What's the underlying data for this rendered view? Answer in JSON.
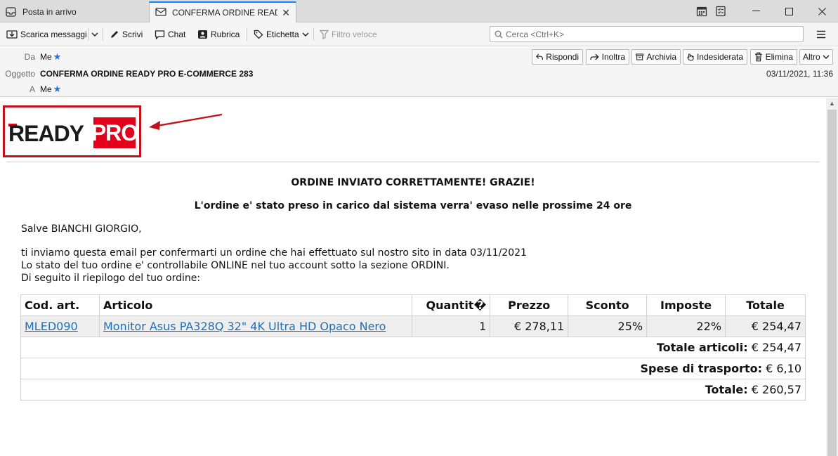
{
  "tabs": [
    {
      "label": "Posta in arrivo",
      "icon": "inbox-icon",
      "active": false
    },
    {
      "label": "CONFERMA ORDINE READY PRO",
      "icon": "mail-icon",
      "active": true
    }
  ],
  "window_controls": {
    "minimize": "—",
    "maximize": "☐",
    "close": "✕"
  },
  "toolbar": {
    "get_messages": "Scarica messaggi",
    "write": "Scrivi",
    "chat": "Chat",
    "address_book": "Rubrica",
    "tag": "Etichetta",
    "quick_filter": "Filtro veloce",
    "search_placeholder": "Cerca <Ctrl+K>"
  },
  "header": {
    "from_label": "Da",
    "from_value": "Me",
    "subject_label": "Oggetto",
    "subject_value": "CONFERMA ORDINE READY PRO E-COMMERCE 283",
    "to_label": "A",
    "to_value": "Me",
    "date": "03/11/2021, 11:36",
    "actions": {
      "reply": "Rispondi",
      "forward": "Inoltra",
      "archive": "Archivia",
      "junk": "Indesiderata",
      "delete": "Elimina",
      "more": "Altro"
    }
  },
  "message": {
    "logo": {
      "black_part": "READY",
      "red_part": "PRO"
    },
    "heading": "ORDINE INVIATO CORRETTAMENTE! GRAZIE!",
    "subheading": "L'ordine e' stato preso in carico dal sistema verra' evaso nelle prossime 24 ore",
    "greeting": "Salve BIANCHI GIORGIO,",
    "line1": "ti inviamo questa email per confermarti un ordine che hai effettuato sul nostro sito in data 03/11/2021",
    "line2": "Lo stato del tuo ordine e' controllabile ONLINE nel tuo account sotto la sezione ORDINI.",
    "line3": "Di seguito il riepilogo del tuo ordine:",
    "table": {
      "headers": [
        "Cod. art.",
        "Articolo",
        "Quantit�",
        "Prezzo",
        "Sconto",
        "Imposte",
        "Totale"
      ],
      "rows": [
        {
          "code": "MLED090",
          "article": "Monitor Asus PA328Q 32\" 4K Ultra HD Opaco Nero",
          "qty": "1",
          "price": "€ 278,11",
          "discount": "25%",
          "tax": "22%",
          "total": "€ 254,47"
        }
      ],
      "summary": {
        "items_label": "Totale articoli:",
        "items_value": "€ 254,47",
        "shipping_label": "Spese di trasporto:",
        "shipping_value": "€ 6,10",
        "total_label": "Totale:",
        "total_value": "€ 260,57"
      }
    }
  },
  "colors": {
    "accent": "#0a84ff",
    "logo_red": "#e2001a",
    "highlight_border": "#c1121c",
    "link": "#1f6fb6"
  }
}
